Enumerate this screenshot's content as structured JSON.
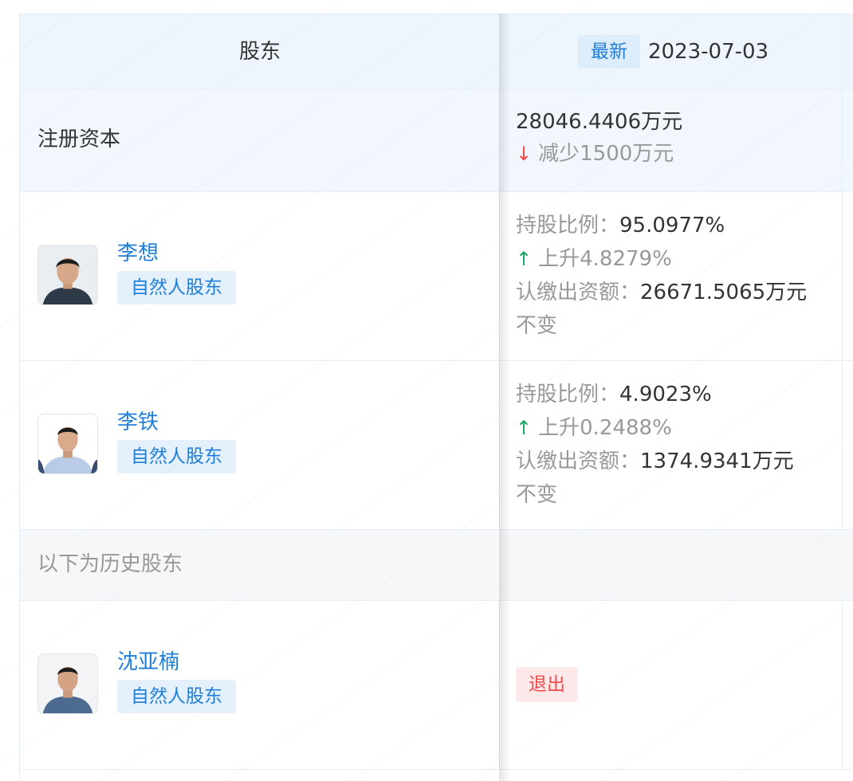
{
  "header": {
    "col_shareholder": "股东",
    "latest_badge": "最新",
    "date": "2023-07-03"
  },
  "registered_capital": {
    "label": "注册资本",
    "value": "28046.4406万元",
    "change_text": "减少1500万元",
    "change_direction": "down"
  },
  "shareholders": [
    {
      "name": "李想",
      "tag": "自然人股东",
      "ratio_label": "持股比例：",
      "ratio_value": "95.0977%",
      "ratio_change": "上升4.8279%",
      "subscribed_label": "认缴出资额：",
      "subscribed_value": "26671.5065万元",
      "subscribed_change": "不变"
    },
    {
      "name": "李铁",
      "tag": "自然人股东",
      "ratio_label": "持股比例：",
      "ratio_value": "4.9023%",
      "ratio_change": "上升0.2488%",
      "subscribed_label": "认缴出资额：",
      "subscribed_value": "1374.9341万元",
      "subscribed_change": "不变"
    }
  ],
  "history": {
    "label": "以下为历史股东",
    "items": [
      {
        "name": "沈亚楠",
        "tag": "自然人股东",
        "status": "退出"
      }
    ]
  },
  "icons": {
    "arrow_down": "↓",
    "arrow_up": "↑"
  },
  "colors": {
    "link_blue": "#1e7ed8",
    "up_green": "#16a864",
    "down_red": "#f04b4b",
    "exit_red": "#ef4b4b"
  }
}
